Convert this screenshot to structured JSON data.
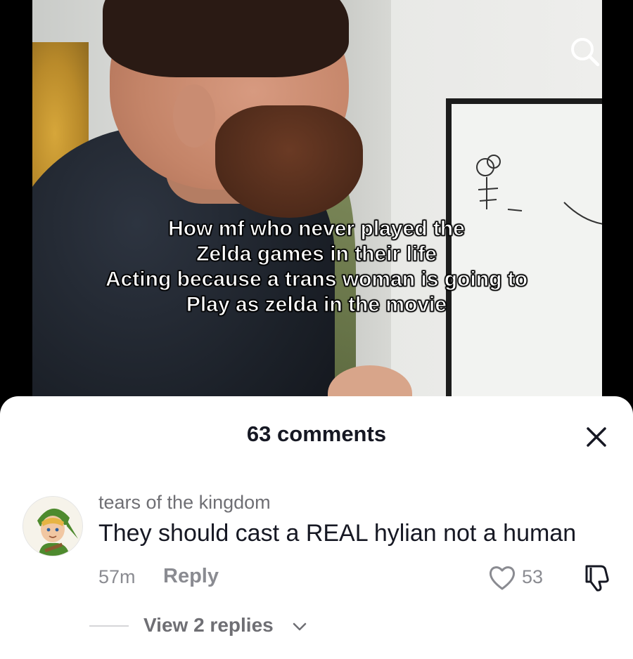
{
  "video": {
    "caption_lines": [
      "How mf who never played the",
      "Zelda games in their life",
      "Acting because a trans woman is going to",
      "Play as zelda in the movie"
    ]
  },
  "comments_sheet": {
    "title": "63 comments",
    "comment": {
      "username": "tears of the kingdom",
      "text": "They should cast a REAL hylian not a human",
      "time": "57m",
      "reply_label": "Reply",
      "like_count": "53",
      "view_replies_label": "View 2 replies"
    }
  },
  "icons": {
    "search": "search-icon",
    "close": "close-icon",
    "like": "heart-icon",
    "dislike": "thumbs-down-icon",
    "expand": "chevron-down-icon"
  },
  "colors": {
    "text_primary": "#161823",
    "text_secondary": "#8a8b91",
    "sheet_bg": "#ffffff"
  }
}
